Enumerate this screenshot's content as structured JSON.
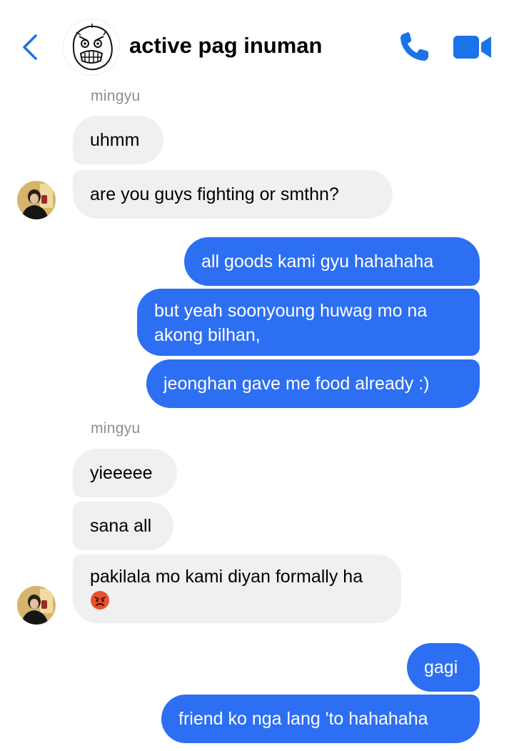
{
  "header": {
    "title": "active pag inuman",
    "back_icon": "chevron-left-icon",
    "call_icon": "phone-icon",
    "video_icon": "video-camera-icon",
    "accent_color": "#1a73e8"
  },
  "messages": [
    {
      "sender": "mingyu",
      "text": "uhmm"
    },
    {
      "text": "are you guys fighting or smthn?"
    },
    {
      "text": "all goods kami gyu hahahaha"
    },
    {
      "text": "but yeah soonyoung huwag mo na akong bilhan,"
    },
    {
      "text": "jeonghan gave me food already :)"
    },
    {
      "sender": "mingyu",
      "text": "yieeeee"
    },
    {
      "text": "sana all"
    },
    {
      "text": "pakilala mo kami diyan formally ha",
      "emoji": "angry-face-emoji"
    },
    {
      "text": "gagi"
    },
    {
      "text": "friend ko nga lang 'to hahahaha"
    }
  ],
  "colors": {
    "outgoing": "#2d6ff2",
    "incoming": "#f0f0f0",
    "sender_name": "#8e8e93"
  }
}
